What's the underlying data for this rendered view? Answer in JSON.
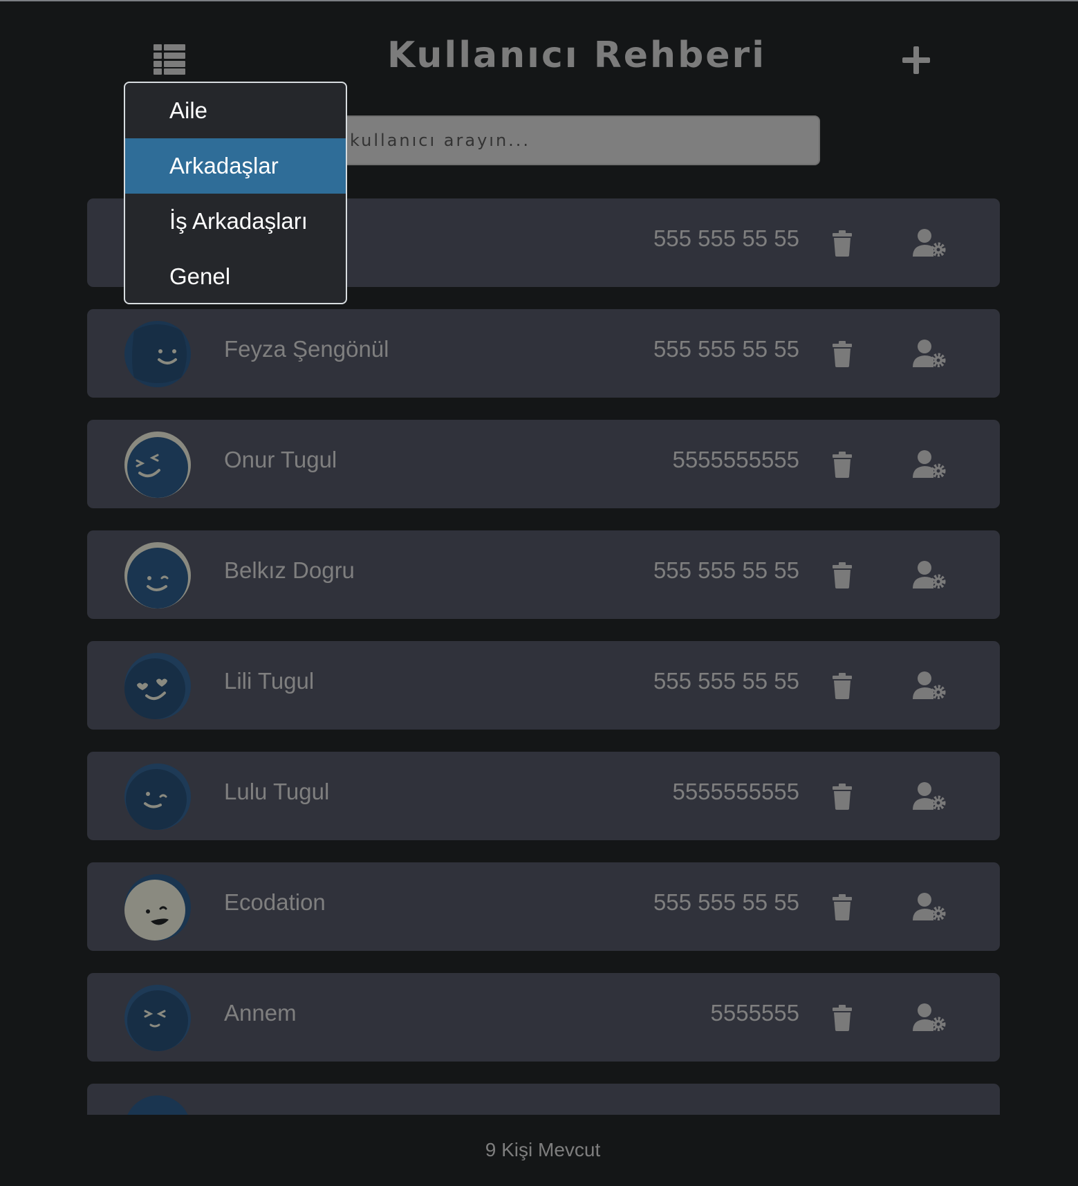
{
  "header": {
    "title": "Kullanıcı Rehberi",
    "menu_icon": "grid-list-icon",
    "add_icon": "plus-icon"
  },
  "search": {
    "placeholder": "kullanıcı arayın..."
  },
  "dropdown": {
    "items": [
      {
        "label": "Aile"
      },
      {
        "label": "Arkadaşlar"
      },
      {
        "label": "İş Arkadaşları"
      },
      {
        "label": "Genel"
      }
    ],
    "active": "Arkadaşlar"
  },
  "contacts": [
    {
      "name": "",
      "phone": "555 555 55 55"
    },
    {
      "name": "Feyza Şengönül",
      "phone": "555 555 55 55",
      "avatar": "smile-icon"
    },
    {
      "name": "Onur Tugul",
      "phone": "5555555555",
      "avatar": "squint-wink-icon"
    },
    {
      "name": "Belkız Dogru",
      "phone": "555 555 55 55",
      "avatar": "wink-icon"
    },
    {
      "name": "Lili Tugul",
      "phone": "555 555 55 55",
      "avatar": "heart-eyes-icon"
    },
    {
      "name": "Lulu Tugul",
      "phone": "5555555555",
      "avatar": "wink-icon"
    },
    {
      "name": "Ecodation",
      "phone": "555 555 55 55",
      "avatar": "grin-wink-icon"
    },
    {
      "name": "Annem",
      "phone": "5555555",
      "avatar": "squint-icon"
    },
    {
      "name": "",
      "phone": ""
    }
  ],
  "row_icons": {
    "delete": "trash-icon",
    "edit": "user-gear-icon"
  },
  "footer": {
    "count": "9 Kişi Mevcut"
  },
  "colors": {
    "background": "#141617",
    "row": "#30323b",
    "text_muted": "#7f7f7f",
    "dropdown_bg": "#25272b",
    "dropdown_active": "#2f6d98",
    "avatar_dark": "#1a3550",
    "avatar_light": "#8a8a80"
  }
}
